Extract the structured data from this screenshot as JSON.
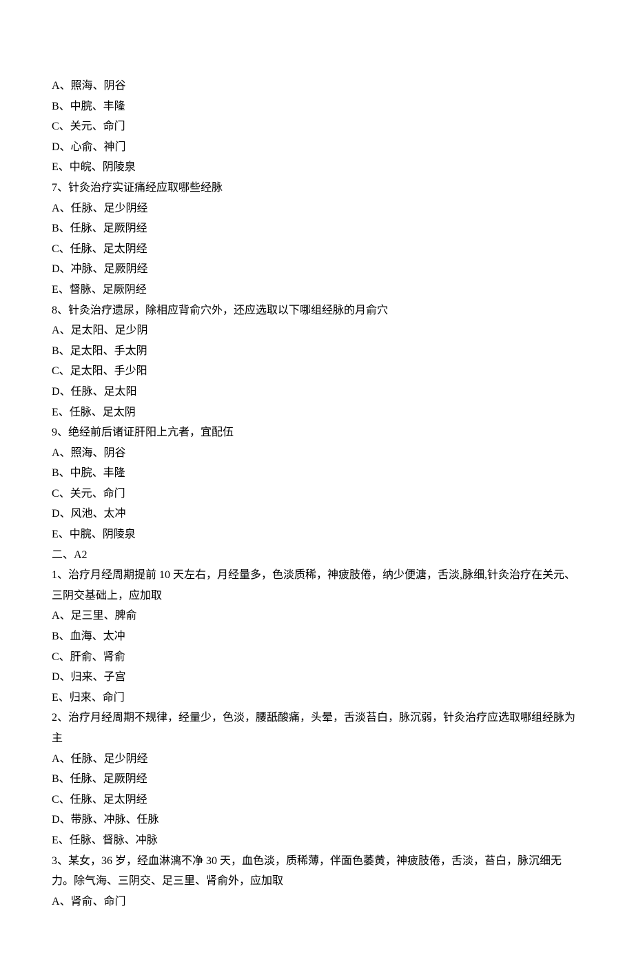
{
  "lines": [
    "A、照海、阴谷",
    "B、中脘、丰隆",
    "C、关元、命门",
    "D、心俞、神门",
    "E、中皖、阴陵泉",
    "7、针灸治疗实证痛经应取哪些经脉",
    "A、任脉、足少阴经",
    "B、任脉、足厥阴经",
    "C、任脉、足太阴经",
    "D、冲脉、足厥阴经",
    "E、督脉、足厥阴经",
    "8、针灸治疗遗尿，除相应背俞穴外，还应选取以下哪组经脉的月俞穴",
    "A、足太阳、足少阴",
    "B、足太阳、手太阴",
    "C、足太阳、手少阳",
    "D、任脉、足太阳",
    "E、任脉、足太阴",
    "9、绝经前后诸证肝阳上亢者，宜配伍",
    "A、照海、阴谷",
    "B、中脘、丰隆",
    "C、关元、命门",
    "D、风池、太冲",
    "E、中脘、阴陵泉",
    "二、A2",
    "1、治疗月经周期提前 10 天左右，月经量多，色淡质稀，神疲肢倦，纳少便溏，舌淡,脉细,针灸治疗在关元、三阴交基础上，应加取",
    "A、足三里、脾俞",
    "B、血海、太冲",
    "C、肝俞、肾俞",
    "D、归来、子宫",
    "E、归来、命门",
    "2、治疗月经周期不规律，经量少，色淡，腰舐酸痛，头晕，舌淡苔白，脉沉弱，针灸治疗应选取哪组经脉为主",
    "A、任脉、足少阴经",
    "B、任脉、足厥阴经",
    "C、任脉、足太阴经",
    "D、带脉、冲脉、任脉",
    "E、任脉、督脉、冲脉",
    "3、某女，36 岁，经血淋漓不净 30 天，血色淡，质稀薄，伴面色萎黄，神疲肢倦，舌淡，苔白，脉沉细无力。除气海、三阴交、足三里、肾俞外，应加取",
    "A、肾俞、命门"
  ]
}
